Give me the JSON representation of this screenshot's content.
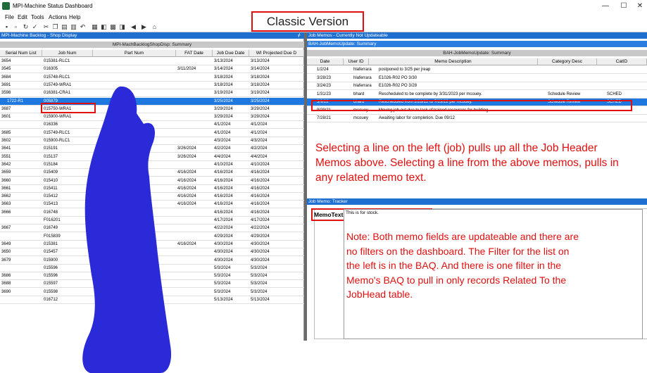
{
  "window": {
    "title": "MPI-Machine Status Dashboard",
    "minimize": "—",
    "maximize": "☐",
    "close": "✕"
  },
  "menu": [
    "File",
    "Edit",
    "Tools",
    "Actions",
    "Help"
  ],
  "overlay_title": "Classic Version",
  "left_panel": {
    "header": "MPI-Machine Backlog - Shop Display",
    "subheader": "MPI-MachBacklogShopDisp: Summary",
    "columns": [
      "Serial Num List",
      "Job Num",
      "Part Num",
      "FAT Date",
      "Job Due Date",
      "WI Projected Due D"
    ],
    "rows": [
      {
        "serial": "3654",
        "job": "015381-RLC1",
        "fat": "",
        "due": "3/13/2024",
        "wi": "3/13/2024"
      },
      {
        "serial": "3545",
        "job": "016305",
        "fat": "3/11/2024",
        "due": "3/14/2024",
        "wi": "3/14/2024"
      },
      {
        "serial": "3684",
        "job": "015748-RLC1",
        "fat": "",
        "due": "3/18/2024",
        "wi": "3/18/2024"
      },
      {
        "serial": "3691",
        "job": "015749-WRA1",
        "fat": "",
        "due": "3/18/2024",
        "wi": "3/18/2024"
      },
      {
        "serial": "3598",
        "job": "016381-CRA1",
        "fat": "",
        "due": "3/19/2024",
        "wi": "3/19/2024"
      },
      {
        "serial": "1722-R1",
        "job": "005879",
        "fat": "",
        "due": "3/25/2024",
        "wi": "3/25/2024",
        "selected": true
      },
      {
        "serial": "3687",
        "job": "015750-WRA1",
        "fat": "",
        "due": "3/29/2024",
        "wi": "3/29/2024"
      },
      {
        "serial": "3601",
        "job": "015900-WRA1",
        "fat": "",
        "due": "3/29/2024",
        "wi": "3/29/2024"
      },
      {
        "serial": "",
        "job": "016336",
        "fat": "",
        "due": "4/1/2024",
        "wi": "4/1/2024"
      },
      {
        "serial": "3685",
        "job": "015749-RLC1",
        "fat": "",
        "due": "4/1/2024",
        "wi": "4/1/2024"
      },
      {
        "serial": "3602",
        "job": "015900-RLC1",
        "fat": "",
        "due": "4/3/2024",
        "wi": "4/3/2024"
      },
      {
        "serial": "3641",
        "job": "015191",
        "fat": "3/26/2024",
        "due": "4/2/2024",
        "wi": "4/2/2024"
      },
      {
        "serial": "3551",
        "job": "015137",
        "fat": "3/26/2024",
        "due": "4/4/2024",
        "wi": "4/4/2024"
      },
      {
        "serial": "3642",
        "job": "015184",
        "fat": "",
        "due": "4/10/2024",
        "wi": "4/10/2024"
      },
      {
        "serial": "3659",
        "job": "015409",
        "fat": "4/16/2024",
        "due": "4/16/2024",
        "wi": "4/16/2024"
      },
      {
        "serial": "3660",
        "job": "015410",
        "fat": "4/16/2024",
        "due": "4/16/2024",
        "wi": "4/16/2024"
      },
      {
        "serial": "3661",
        "job": "015411",
        "fat": "4/16/2024",
        "due": "4/16/2024",
        "wi": "4/16/2024"
      },
      {
        "serial": "3662",
        "job": "015412",
        "fat": "4/16/2024",
        "due": "4/16/2024",
        "wi": "4/16/2024"
      },
      {
        "serial": "3663",
        "job": "015413",
        "fat": "4/16/2024",
        "due": "4/16/2024",
        "wi": "4/16/2024"
      },
      {
        "serial": "3666",
        "job": "016748",
        "fat": "",
        "due": "4/16/2024",
        "wi": "4/16/2024"
      },
      {
        "serial": "",
        "job": "F016201",
        "fat": "",
        "due": "4/17/2024",
        "wi": "4/17/2024"
      },
      {
        "serial": "3667",
        "job": "016749",
        "fat": "",
        "due": "4/22/2024",
        "wi": "4/22/2024"
      },
      {
        "serial": "",
        "job": "F015839",
        "fat": "",
        "due": "4/29/2024",
        "wi": "4/29/2024"
      },
      {
        "serial": "3649",
        "job": "015381",
        "fat": "4/16/2024",
        "due": "4/30/2024",
        "wi": "4/30/2024"
      },
      {
        "serial": "3650",
        "job": "015457",
        "fat": "",
        "due": "4/30/2024",
        "wi": "4/30/2024"
      },
      {
        "serial": "3679",
        "job": "015900",
        "fat": "",
        "due": "4/30/2024",
        "wi": "4/30/2024"
      },
      {
        "serial": "",
        "job": "015596",
        "fat": "",
        "due": "5/3/2024",
        "wi": "5/3/2024"
      },
      {
        "serial": "3686",
        "job": "015596",
        "fat": "",
        "due": "5/3/2024",
        "wi": "5/3/2024"
      },
      {
        "serial": "3688",
        "job": "015597",
        "fat": "",
        "due": "5/3/2024",
        "wi": "5/3/2024"
      },
      {
        "serial": "3690",
        "job": "015598",
        "fat": "",
        "due": "5/3/2024",
        "wi": "5/3/2024"
      },
      {
        "serial": "",
        "job": "016712",
        "fat": "",
        "due": "5/13/2024",
        "wi": "5/13/2024"
      }
    ]
  },
  "memo_panel": {
    "header": "Job Memos - Currently Not Updateable",
    "header2": "BAH-JobMemoUpdate: Summary",
    "subheader": "BAH-JobMemoUpdate: Summary",
    "columns": [
      "Date",
      "User ID",
      "Memo Description",
      "Category Desc",
      "CatID"
    ],
    "rows": [
      {
        "date": "1/2/24",
        "user": "hlaferrara",
        "desc": "postponed to 3/25 per jreap",
        "cat": "",
        "catid": ""
      },
      {
        "date": "3/28/23",
        "user": "hlaferrara",
        "desc": "E1026-R02 PO 3/30",
        "cat": "",
        "catid": ""
      },
      {
        "date": "3/24/23",
        "user": "hlaferrara",
        "desc": "E1026-R02 PO 3/28",
        "cat": "",
        "catid": ""
      },
      {
        "date": "1/31/23",
        "user": "bhard",
        "desc": "Rescheduled to be complete by 3/31/2023 per mcouey.",
        "cat": "Schedule Review",
        "catid": "SCHED"
      },
      {
        "date": "3/9/22",
        "user": "bhard",
        "desc": "Rescheduled from 2/28/22 to 7/29/22 per mcouey.",
        "cat": "Schedule Review",
        "catid": "SCHED",
        "selected": true
      },
      {
        "date": "9/29/21",
        "user": "mcouey",
        "desc": "Moving job out due to lack of trained resources for building",
        "cat": "",
        "catid": ""
      },
      {
        "date": "7/28/21",
        "user": "mcouey",
        "desc": "Awaiting labor for completion.  Due 09/12",
        "cat": "",
        "catid": ""
      }
    ]
  },
  "note1": "Selecting a line on the left (job) pulls up all the Job Header Memos above. Selecting a line from the above memos, pulls in any related memo text.",
  "tracker": {
    "header": "Job Memo: Tracker",
    "label": "MemoText",
    "value": "This is for stock."
  },
  "note2": "Note: Both memo fields are updateable and there are no filters on the dashboard. The Filter for the list on the left is in the BAQ. And there is one filter in the Memo's BAQ to pull in only records Related To the JobHead table."
}
